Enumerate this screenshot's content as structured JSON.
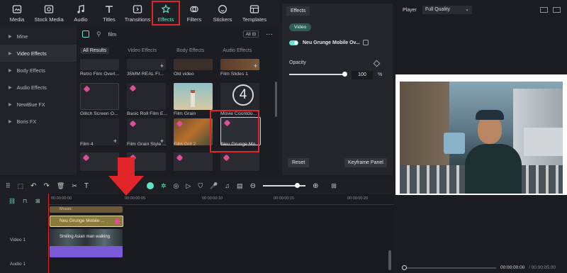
{
  "toolbar": {
    "items": [
      {
        "label": "Media",
        "icon": "media-icon"
      },
      {
        "label": "Stock Media",
        "icon": "stock-media-icon"
      },
      {
        "label": "Audio",
        "icon": "audio-icon"
      },
      {
        "label": "Titles",
        "icon": "titles-icon"
      },
      {
        "label": "Transitions",
        "icon": "transitions-icon"
      },
      {
        "label": "Effects",
        "icon": "effects-icon"
      },
      {
        "label": "Filters",
        "icon": "filters-icon"
      },
      {
        "label": "Stickers",
        "icon": "stickers-icon"
      },
      {
        "label": "Templates",
        "icon": "templates-icon"
      }
    ]
  },
  "sidebar": {
    "items": [
      "Mine",
      "Video Effects",
      "Body Effects",
      "Audio Effects",
      "NewBlue FX",
      "Boris FX"
    ]
  },
  "search": {
    "value": "film",
    "filter_label": "All"
  },
  "content": {
    "tabs": [
      "All Results",
      "Video Effects",
      "Body Effects",
      "Audio Effects"
    ],
    "tiles": [
      "Retro Film Overl...",
      "35MM REAL FI...",
      "Old video",
      "Film Slides 1",
      "Glitch Screen O...",
      "Basic Roll Film E...",
      "Film Grain",
      "Movie Countdo...",
      "Film 4",
      "Film Grain Style ...",
      "Film Grit 2",
      "Neu Grunge Mo..."
    ],
    "countdown_digit": "4"
  },
  "props": {
    "tab": "Effects",
    "subtab": "Video",
    "effect_name": "Neu Grunge Mobile Ov...",
    "opacity_label": "Opacity",
    "opacity_value": "100",
    "opacity_unit": "%",
    "opacity_level": 1.0,
    "reset_label": "Reset",
    "keyframe_label": "Keyframe Panel"
  },
  "player": {
    "label": "Player",
    "quality": "Full Quality",
    "timecode": "00:00:00:00",
    "total": "/ 00:00:05:00"
  },
  "timeline": {
    "ticks": [
      "00:00:00:00",
      "00:00:00:05",
      "00:00:00:10",
      "00:00:00:15",
      "00:00:00:20"
    ],
    "clip_effect": "Neu Grunge Mobile ...",
    "clip_video": "Smiling Asian man walking",
    "track_video": "Video 1",
    "track_audio": "Audio 1",
    "track_title": "Mosaic"
  },
  "colors": {
    "accent": "#63e3c8",
    "highlight": "#e1252a",
    "effect_clip": "#8a7a3c",
    "video_clip": "#7a5ad6"
  }
}
